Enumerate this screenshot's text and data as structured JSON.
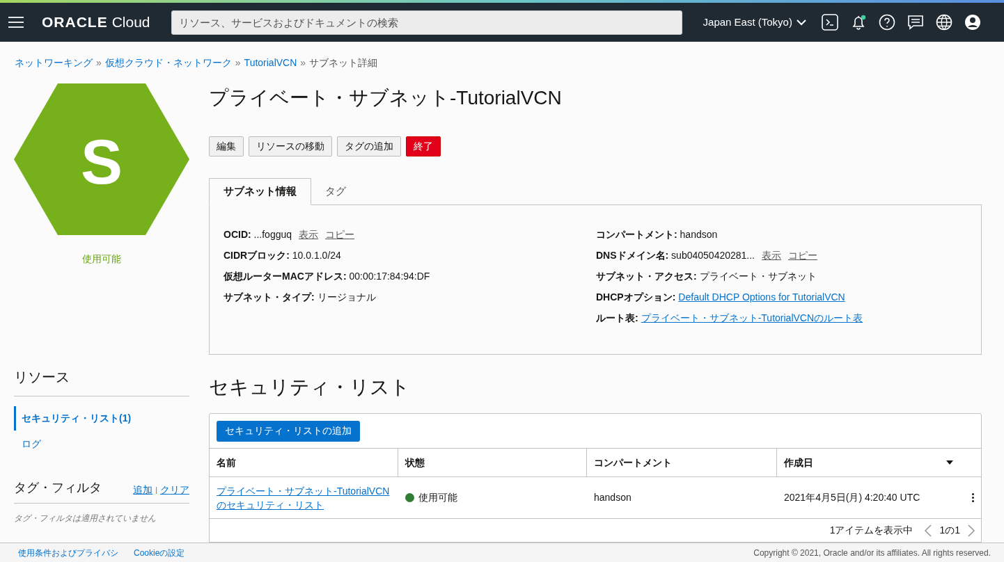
{
  "header": {
    "logo_brand": "ORACLE",
    "logo_product": "Cloud",
    "search": {
      "placeholder": "リソース、サービスおよびドキュメントの検索"
    },
    "region": "Japan East (Tokyo)",
    "notification_dot": true
  },
  "breadcrumbs": [
    {
      "label": "ネットワーキング",
      "link": true
    },
    {
      "separator": "»",
      "label": "仮想クラウド・ネットワーク",
      "link": true
    },
    {
      "separator": "»",
      "label": "TutorialVCN",
      "link": true
    },
    {
      "separator": "»",
      "label": "サブネット詳細",
      "link": false
    }
  ],
  "resource_icon": {
    "letter": "S",
    "status": "使用可能"
  },
  "title": "プライベート・サブネット-TutorialVCN",
  "actions": [
    {
      "label": "編集",
      "kind": "default"
    },
    {
      "label": "リソースの移動",
      "kind": "default"
    },
    {
      "label": "タグの追加",
      "kind": "default"
    },
    {
      "label": "終了",
      "kind": "danger"
    }
  ],
  "tabs": [
    {
      "label": "サブネット情報",
      "selected": true
    },
    {
      "label": "タグ",
      "selected": false
    }
  ],
  "details": {
    "left": [
      {
        "label": "OCID:",
        "value": "...fogguq",
        "kind": "actions",
        "links": [
          "表示",
          "コピー"
        ]
      },
      {
        "label": "CIDRブロック:",
        "value": "10.0.1.0/24",
        "kind": "text"
      },
      {
        "label": "仮想ルーターMACアドレス:",
        "value": "00:00:17:84:94:DF",
        "kind": "text"
      },
      {
        "label": "サブネット・タイプ:",
        "value": "リージョナル",
        "kind": "text"
      }
    ],
    "right": [
      {
        "label": "コンパートメント:",
        "value": "handson",
        "kind": "text"
      },
      {
        "label": "DNSドメイン名:",
        "value": "sub04050420281...",
        "kind": "actions",
        "links": [
          "表示",
          "コピー"
        ]
      },
      {
        "label": "サブネット・アクセス:",
        "value": "プライベート・サブネット",
        "kind": "text"
      },
      {
        "label": "DHCPオプション:",
        "value": "Default DHCP Options for TutorialVCN",
        "kind": "link"
      },
      {
        "label": "ルート表:",
        "value": "プライベート・サブネット-TutorialVCNのルート表",
        "kind": "link"
      }
    ]
  },
  "sidebar": {
    "title": "リソース",
    "items": [
      {
        "label": "セキュリティ・リスト(1)",
        "selected": true
      },
      {
        "label": "ログ",
        "selected": false
      }
    ],
    "tag_filter": {
      "title": "タグ・フィルタ",
      "add": "追加",
      "separator": "|",
      "clear": "クリア",
      "empty": "タグ・フィルタは適用されていません"
    }
  },
  "section_title": "セキュリティ・リスト",
  "add_button": "セキュリティ・リストの追加",
  "table": {
    "columns": [
      "名前",
      "状態",
      "コンパートメント",
      "作成日"
    ],
    "rows": [
      {
        "name": "プライベート・サブネット-TutorialVCN",
        "name_line2": "のセキュリティ・リスト",
        "status": "使用可能",
        "color": "#2e7d32",
        "compartment": "handson",
        "created": "2021年4月5日(月) 4:20:40 UTC"
      }
    ],
    "footer": "1アイテムを表示中",
    "page": "1の1"
  },
  "footer": {
    "links": [
      "使用条件およびプライバシ",
      "Cookieの設定"
    ],
    "copyright": "Copyright © 2021, Oracle and/or its affiliates. All rights reserved."
  }
}
